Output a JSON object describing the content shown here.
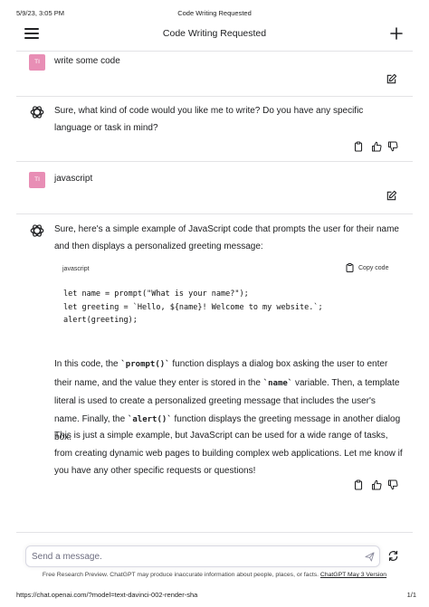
{
  "print_header": {
    "date": "5/9/23, 3:05 PM",
    "title": "Code Writing Requested"
  },
  "header": {
    "title": "Code Writing Requested",
    "menu_icon": "hamburger-menu-icon",
    "new_chat_icon": "plus-icon"
  },
  "messages": [
    {
      "role": "user",
      "avatar": "TI",
      "text": "write some code"
    },
    {
      "role": "assistant",
      "text": "Sure, what kind of code would you like me to write? Do you have any specific language or task in mind?"
    },
    {
      "role": "user",
      "avatar": "TI",
      "text": "javascript"
    },
    {
      "role": "assistant",
      "intro": "Sure, here's a simple example of JavaScript code that prompts the user for their name and then displays a personalized greeting message:",
      "code": {
        "language": "javascript",
        "copy_label": "Copy code",
        "lines": [
          "let name = prompt(\"What is your name?\");",
          "let greeting = `Hello, ${name}! Welcome to my website.`;",
          "alert(greeting);"
        ]
      },
      "explanation": {
        "p1": "In this code, the ",
        "c1": "`prompt()`",
        "p2": " function displays a dialog box asking the user to enter their name, and the value they enter is stored in the ",
        "c2": "`name`",
        "p3": " variable. Then, a template literal is used to create a personalized greeting message that includes the user's name. Finally, the ",
        "c3": "`alert()`",
        "p4": " function displays the greeting message in another dialog box."
      },
      "closing": "This is just a simple example, but JavaScript can be used for a wide range of tasks, from creating dynamic web pages to building complex web applications. Let me know if you have any other specific requests or questions!"
    }
  ],
  "composer": {
    "placeholder": "Send a message."
  },
  "footer": {
    "note": "Free Research Preview. ChatGPT may produce inaccurate information about people, places, or facts.",
    "version_link": "ChatGPT May 3 Version"
  },
  "print_footer": {
    "url": "https://chat.openai.com/?model=text-davinci-002-render-sha",
    "page": "1/1"
  },
  "colors": {
    "user_avatar": "#e88eb5",
    "text": "#202123",
    "divider": "#e3e3e6"
  }
}
